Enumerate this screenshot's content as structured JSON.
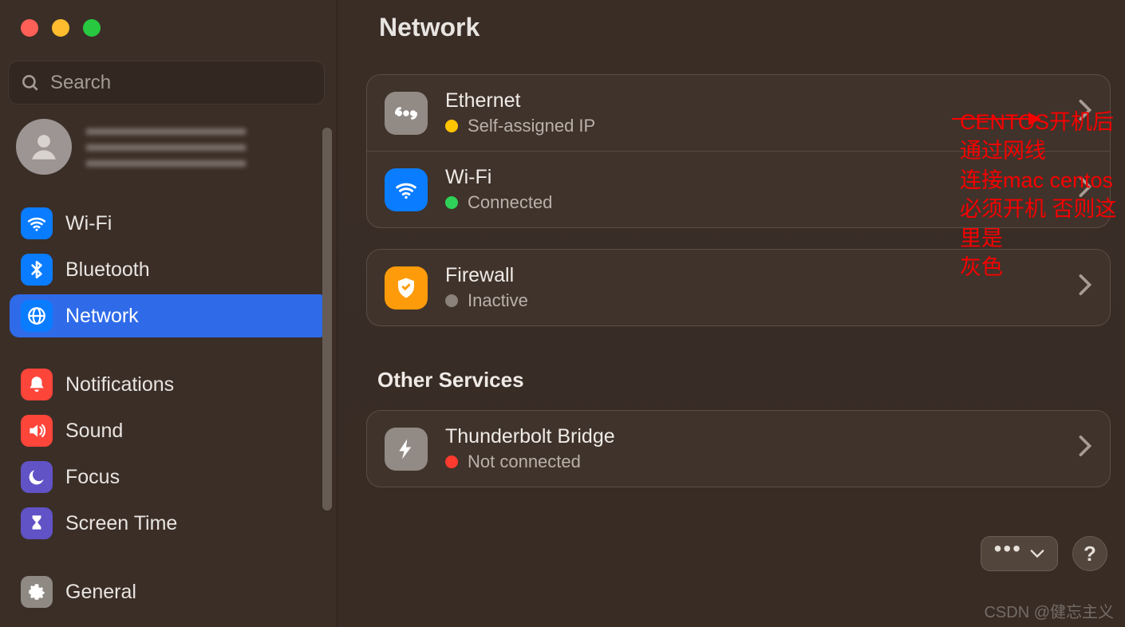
{
  "sidebar": {
    "search_placeholder": "Search",
    "items": [
      {
        "icon": "wifi",
        "label": "Wi-Fi"
      },
      {
        "icon": "bt",
        "label": "Bluetooth"
      },
      {
        "icon": "net",
        "label": "Network",
        "selected": true
      },
      {
        "gap": true
      },
      {
        "icon": "notif",
        "label": "Notifications"
      },
      {
        "icon": "sound",
        "label": "Sound"
      },
      {
        "icon": "focus",
        "label": "Focus"
      },
      {
        "icon": "time",
        "label": "Screen Time"
      },
      {
        "gap": true
      },
      {
        "icon": "general",
        "label": "General"
      }
    ]
  },
  "page": {
    "title": "Network",
    "services": [
      {
        "icon": "eth",
        "title": "Ethernet",
        "status_dot": "yellow",
        "status_text": "Self-assigned IP"
      },
      {
        "icon": "wifi",
        "title": "Wi-Fi",
        "status_dot": "green",
        "status_text": "Connected"
      }
    ],
    "firewall": {
      "icon": "fw",
      "title": "Firewall",
      "status_dot": "grey",
      "status_text": "Inactive"
    },
    "other_label": "Other Services",
    "other_services": [
      {
        "icon": "tb",
        "title": "Thunderbolt Bridge",
        "status_dot": "red",
        "status_text": "Not connected"
      }
    ]
  },
  "annotation": {
    "line1": "CENTOS开机后 通过网线",
    "line2": "连接mac centos必须开机 否则这里是",
    "line3": "灰色"
  },
  "controls": {
    "help_label": "?"
  },
  "watermark": "CSDN @健忘主义"
}
